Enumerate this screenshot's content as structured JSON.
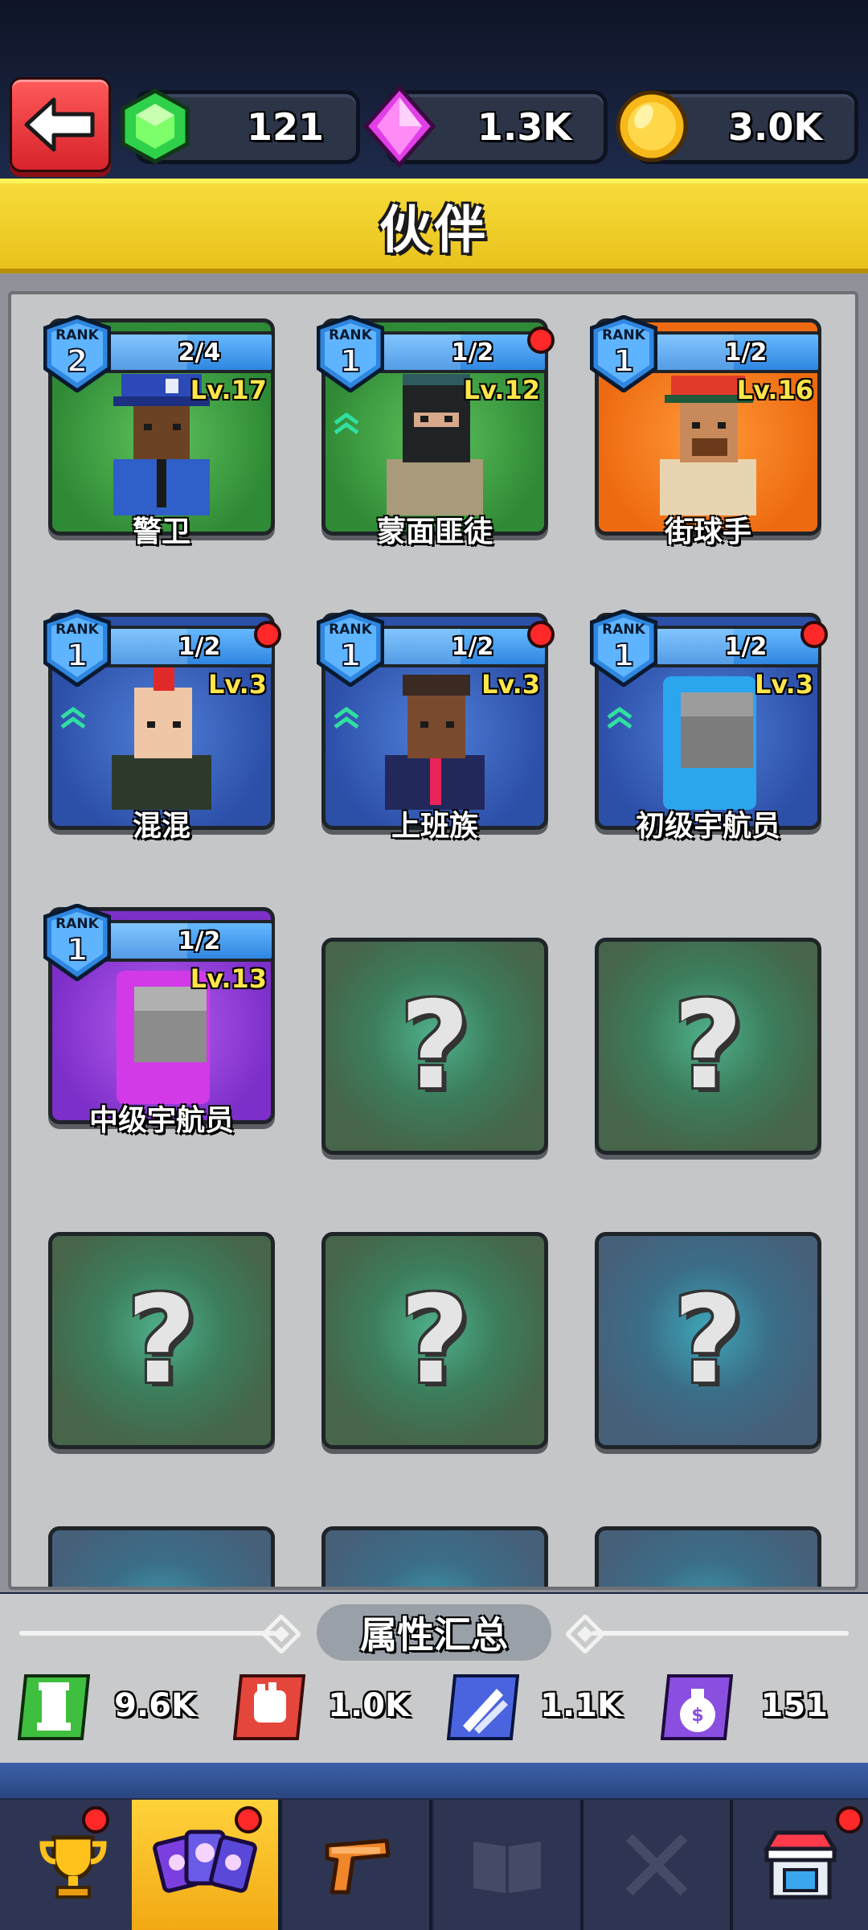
{
  "currencies": {
    "gem": "121",
    "crystal": "1.3K",
    "coin": "3.0K"
  },
  "title": "伙伴",
  "companions": [
    {
      "rank": "2",
      "progress": "2/4",
      "progress_fraction": 0.5,
      "level": "Lv.17",
      "name": "警卫",
      "theme": "green",
      "new": false,
      "upgrade": false
    },
    {
      "rank": "1",
      "progress": "1/2",
      "progress_fraction": 0.5,
      "level": "Lv.12",
      "name": "蒙面匪徒",
      "theme": "green",
      "new": true,
      "upgrade": true
    },
    {
      "rank": "1",
      "progress": "1/2",
      "progress_fraction": 0.5,
      "level": "Lv.16",
      "name": "街球手",
      "theme": "orange",
      "new": false,
      "upgrade": false
    },
    {
      "rank": "1",
      "progress": "1/2",
      "progress_fraction": 0.5,
      "level": "Lv.3",
      "name": "混混",
      "theme": "blue",
      "new": true,
      "upgrade": true
    },
    {
      "rank": "1",
      "progress": "1/2",
      "progress_fraction": 0.5,
      "level": "Lv.3",
      "name": "上班族",
      "theme": "blue",
      "new": true,
      "upgrade": true
    },
    {
      "rank": "1",
      "progress": "1/2",
      "progress_fraction": 0.5,
      "level": "Lv.3",
      "name": "初级宇航员",
      "theme": "blue",
      "new": true,
      "upgrade": true
    },
    {
      "rank": "1",
      "progress": "1/2",
      "progress_fraction": 0.5,
      "level": "Lv.13",
      "name": "中级宇航员",
      "theme": "purple",
      "new": false,
      "upgrade": false
    }
  ],
  "rank_label": "RANK",
  "locked_card_mark": "?",
  "summary": {
    "title": "属性汇总",
    "stats": [
      {
        "icon": "tower-icon",
        "value": "9.6K",
        "color": "#3fbf3f"
      },
      {
        "icon": "fist-icon",
        "value": "1.0K",
        "color": "#e5463c"
      },
      {
        "icon": "auto-missile-icon",
        "value": "1.1K",
        "color": "#4a64e0"
      },
      {
        "icon": "money-bag-icon",
        "value": "151",
        "color": "#8a4fe0"
      }
    ]
  },
  "nav": [
    {
      "icon": "trophy-icon",
      "badge": true,
      "active": false
    },
    {
      "icon": "companion-cards-icon",
      "badge": true,
      "active": true
    },
    {
      "icon": "pistol-icon",
      "badge": false,
      "active": false
    },
    {
      "icon": "book-icon",
      "badge": false,
      "active": false
    },
    {
      "icon": "crossed-swords-icon",
      "badge": false,
      "active": false
    },
    {
      "icon": "shop-icon",
      "badge": true,
      "active": false
    }
  ],
  "colors": {
    "title_band": "#f2d22a",
    "badge_red": "#ff2828",
    "active_tab": "#f6be22"
  }
}
